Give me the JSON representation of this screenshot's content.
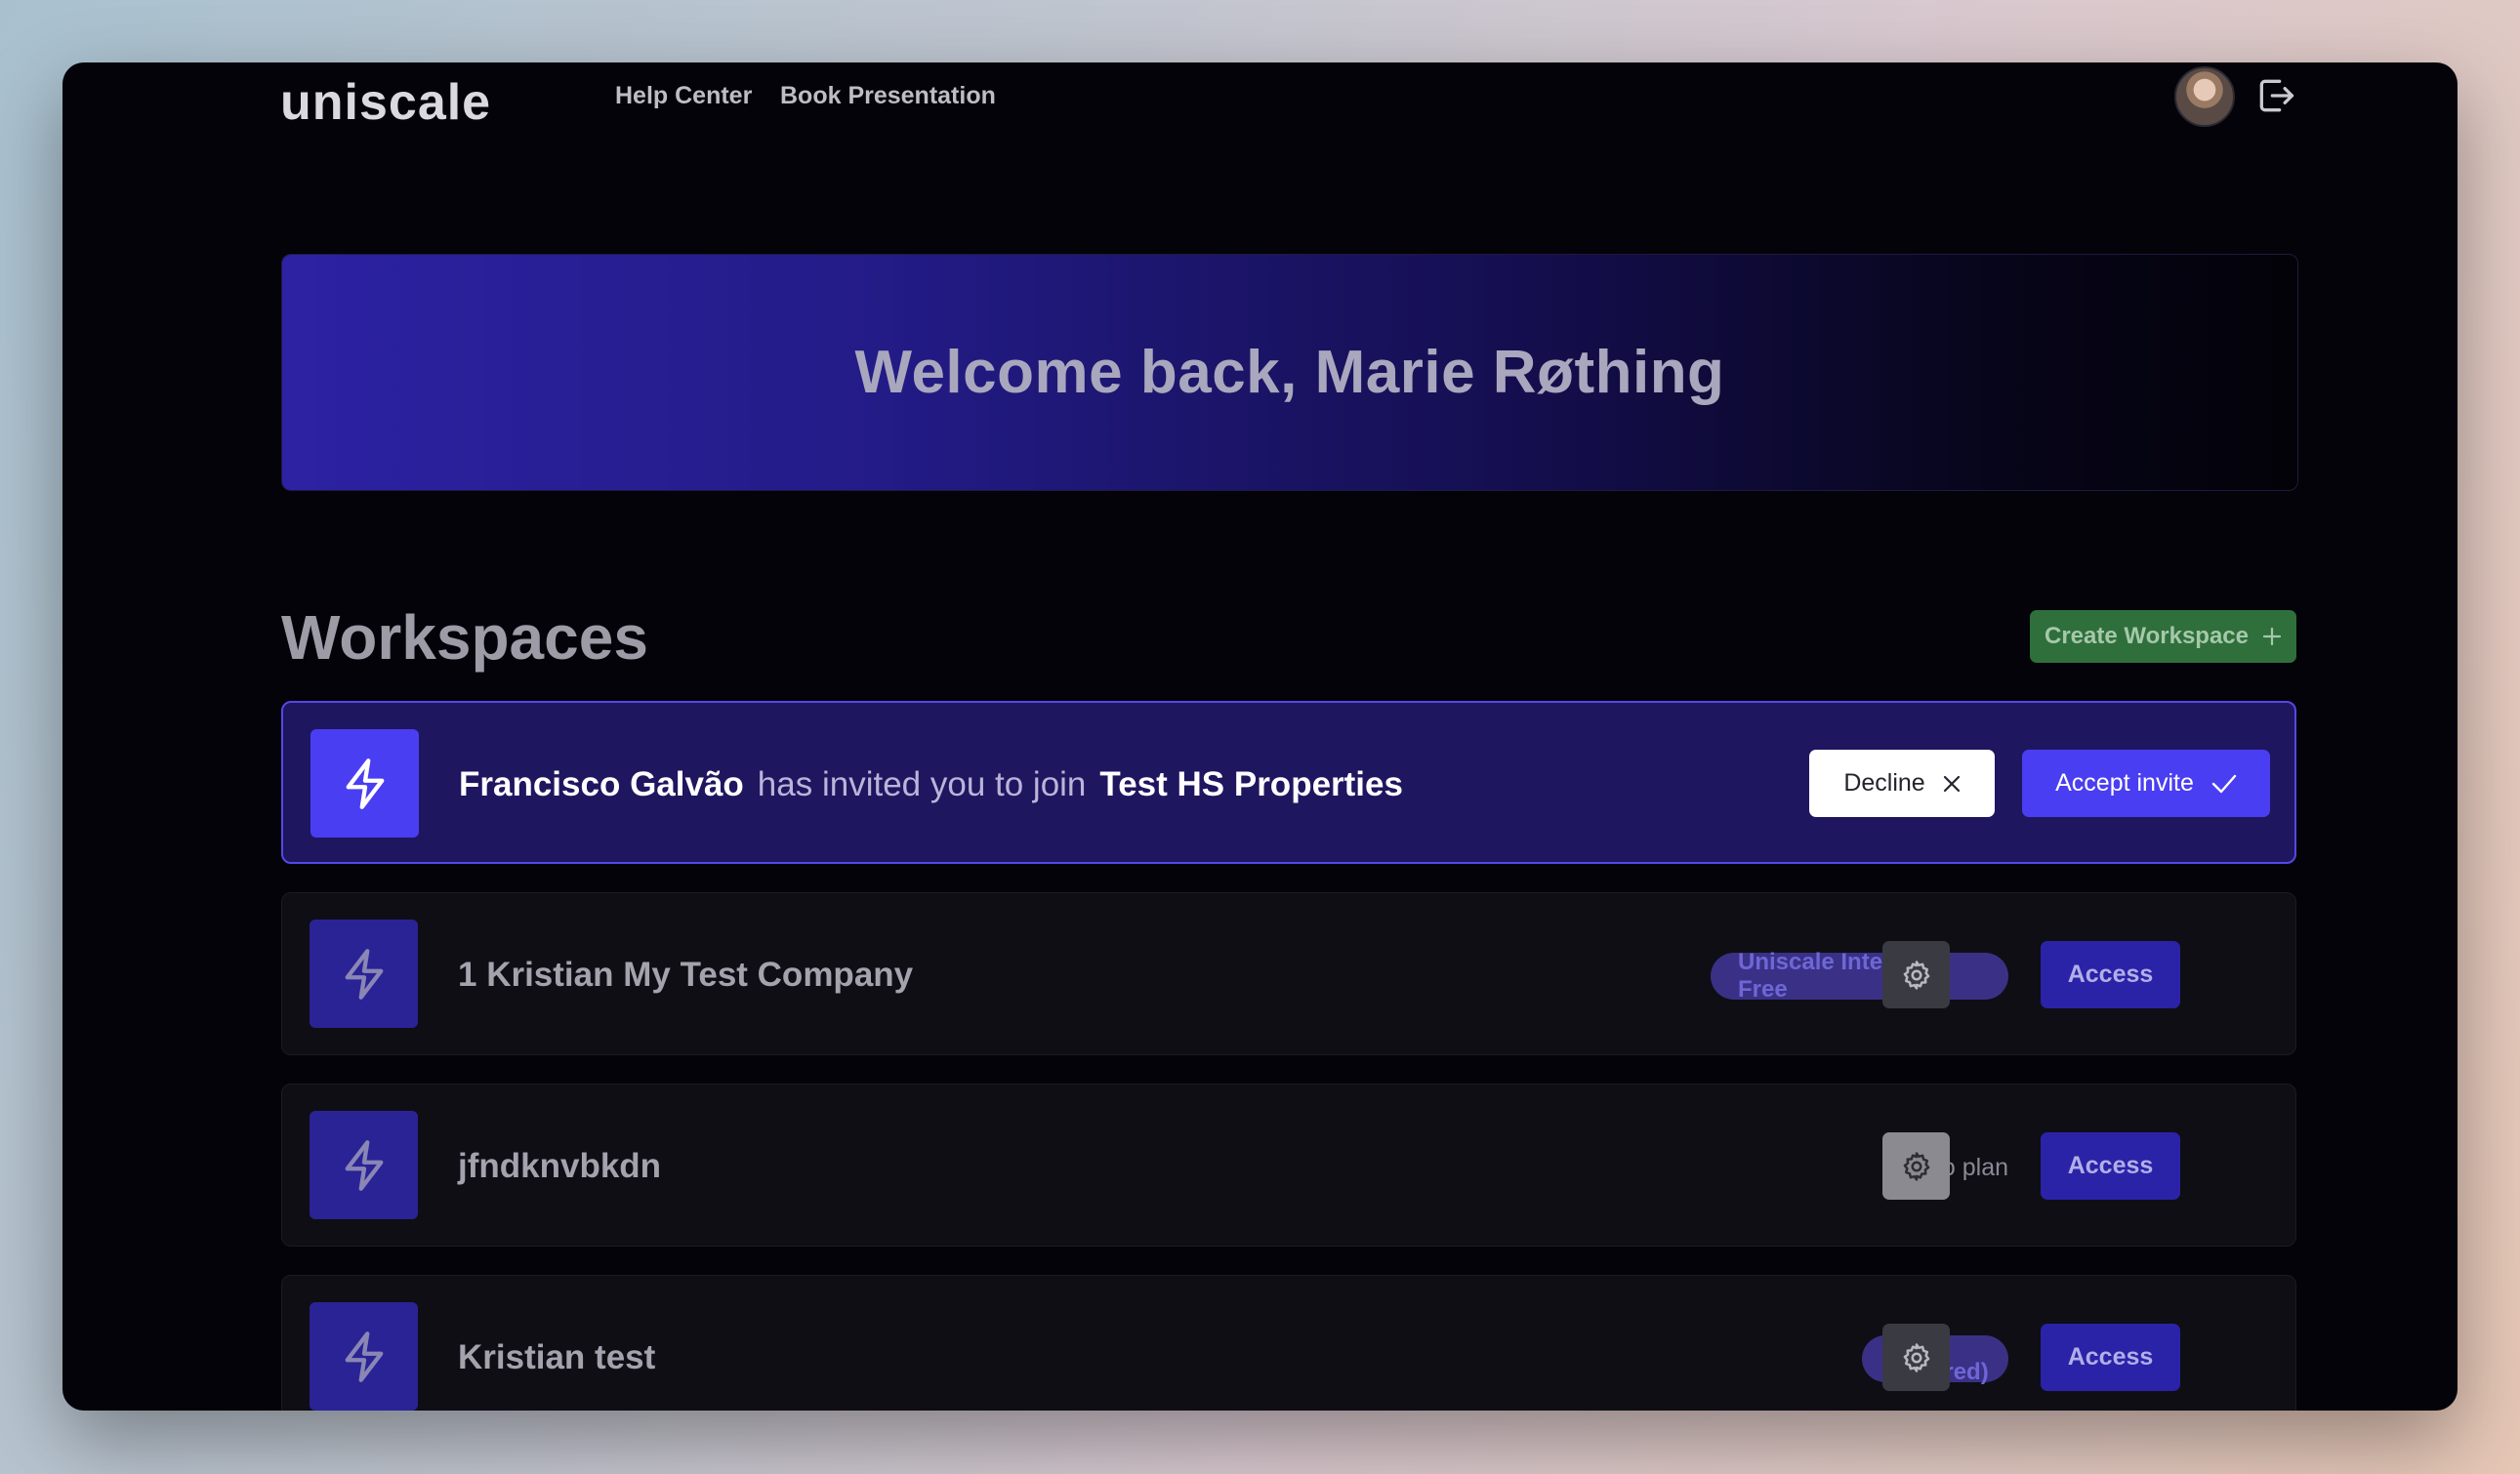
{
  "brand": {
    "logo_text": "uniscale"
  },
  "nav": {
    "links": [
      "Help Center",
      "Book Presentation"
    ]
  },
  "hero": {
    "welcome": "Welcome back, Marie Røthing"
  },
  "workspaces": {
    "title": "Workspaces",
    "create_label": "Create Workspace",
    "invite": {
      "inviter": "Francisco Galvão",
      "message": "has invited you to join",
      "workspace": "Test HS Properties",
      "decline_label": "Decline",
      "accept_label": "Accept invite"
    },
    "items": [
      {
        "name": "1 Kristian My Test Company",
        "plan": "Uniscale Internal Free",
        "access_label": "Access"
      },
      {
        "name": "jfndknvbkdn",
        "plan": "No plan",
        "access_label": "Access"
      },
      {
        "name": "Kristian test",
        "plan": "Pro (metered)",
        "access_label": "Access"
      }
    ]
  },
  "icons": {
    "logout": "logout-icon",
    "workspace": "bolt-icon",
    "settings": "gear-icon",
    "decline": "close-icon",
    "accept": "check-icon",
    "create": "plus-icon"
  },
  "colors": {
    "accent": "#4a3ef2",
    "create_button": "#2f6f3b",
    "invite_bg": "#1f1660",
    "access_button": "#2a23a8"
  }
}
